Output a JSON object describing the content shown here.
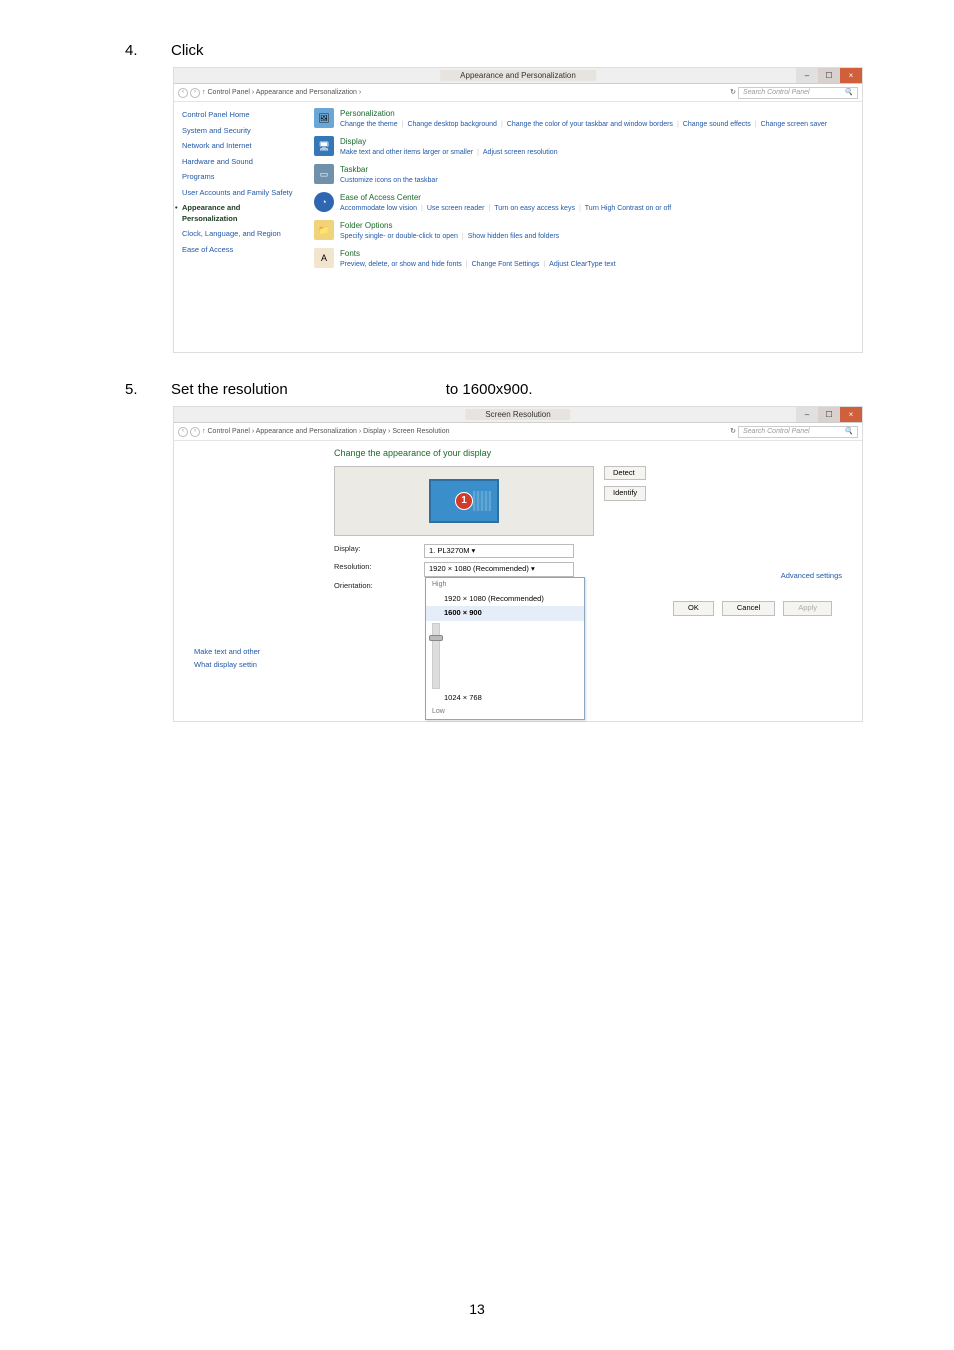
{
  "page_number": "13",
  "steps": [
    {
      "num": "4.",
      "text": "Click"
    },
    {
      "num": "5.",
      "text_prefix": "Set the resolution",
      "text_suffix": "to 1600x900."
    }
  ],
  "shot1": {
    "title": "Appearance and Personalization",
    "win_buttons": {
      "min": "–",
      "max": "☐",
      "close": "×"
    },
    "back": "‹",
    "fwd": "›",
    "up": "↑",
    "breadcrumb": "Control Panel › Appearance and Personalization ›",
    "refresh": "↻",
    "search_placeholder": "Search Control Panel",
    "search_icon": "🔍",
    "sidebar": [
      "Control Panel Home",
      "System and Security",
      "Network and Internet",
      "Hardware and Sound",
      "Programs",
      "User Accounts and Family Safety",
      "Appearance and Personalization",
      "Clock, Language, and Region",
      "Ease of Access"
    ],
    "groups": [
      {
        "icon": "🖼",
        "cls": "g-theme",
        "title": "Personalization",
        "links": [
          "Change the theme",
          "Change desktop background",
          "Change the color of your taskbar and window borders",
          "Change sound effects",
          "Change screen saver"
        ]
      },
      {
        "icon": "🖥",
        "cls": "g-display",
        "title": "Display",
        "links": [
          "Make text and other items larger or smaller",
          "Adjust screen resolution"
        ]
      },
      {
        "icon": "▭",
        "cls": "g-task",
        "title": "Taskbar",
        "links": [
          "Customize icons on the taskbar"
        ]
      },
      {
        "icon": "◔",
        "cls": "g-ease",
        "title": "Ease of Access Center",
        "links": [
          "Accommodate low vision",
          "Use screen reader",
          "Turn on easy access keys",
          "Turn High Contrast on or off"
        ]
      },
      {
        "icon": "📁",
        "cls": "g-folder",
        "title": "Folder Options",
        "links": [
          "Specify single- or double-click to open",
          "Show hidden files and folders"
        ]
      },
      {
        "icon": "A",
        "cls": "g-fonts",
        "title": "Fonts",
        "links": [
          "Preview, delete, or show and hide fonts",
          "Change Font Settings",
          "Adjust ClearType text"
        ]
      }
    ]
  },
  "shot2": {
    "title": "Screen Resolution",
    "win_buttons": {
      "min": "–",
      "max": "☐",
      "close": "×"
    },
    "back": "‹",
    "fwd": "›",
    "up": "↑",
    "breadcrumb": "Control Panel › Appearance and Personalization › Display › Screen Resolution",
    "refresh": "↻",
    "search_placeholder": "Search Control Panel",
    "search_icon": "🔍",
    "heading": "Change the appearance of your display",
    "monitor_badge": "1",
    "detect": "Detect",
    "identify": "Identify",
    "labels": {
      "display": "Display:",
      "resolution": "Resolution:",
      "orientation": "Orientation:"
    },
    "display_value": "1. PL3270M ▾",
    "resolution_value": "1920 × 1080 (Recommended)   ▾",
    "drop": {
      "high": "High",
      "rec": "1920 × 1080 (Recommended)",
      "sel": "1600 × 900",
      "low_val": "1024 × 768",
      "low": "Low"
    },
    "other_links": [
      "Make text and other",
      "What display settin"
    ],
    "advanced": "Advanced settings",
    "ok": "OK",
    "cancel": "Cancel",
    "apply": "Apply"
  }
}
